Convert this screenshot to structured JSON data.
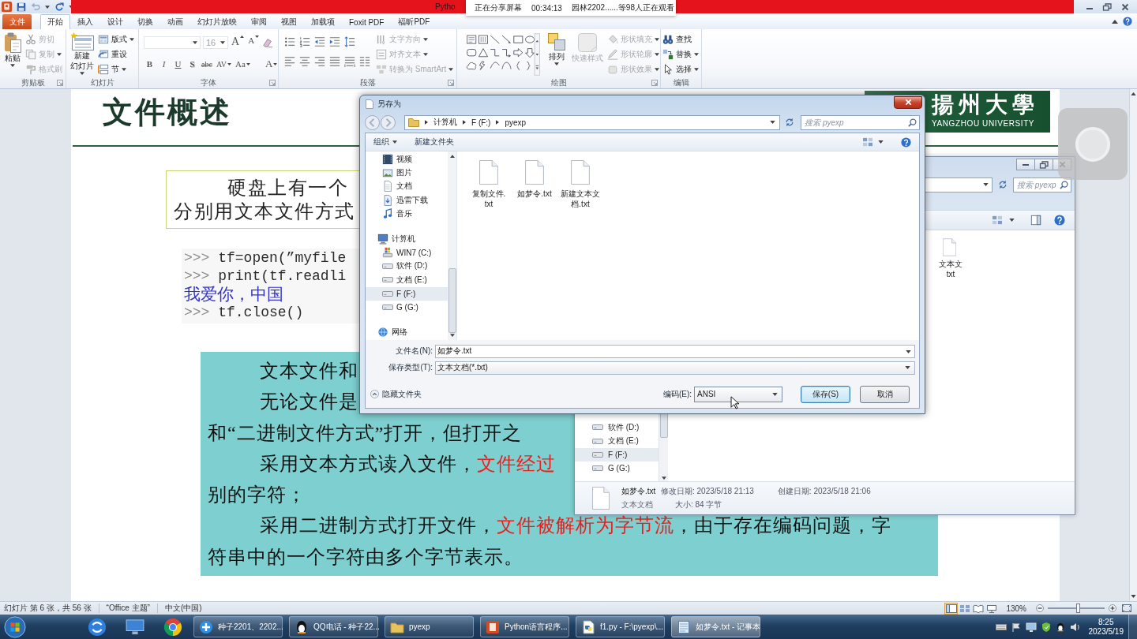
{
  "app_window": {
    "title": "Pytho"
  },
  "share_banner": {
    "status": "正在分享屏幕",
    "elapsed": "00:34:13",
    "viewers": "园林2202......等98人正在观看"
  },
  "ribbon": {
    "file_tab": "文件",
    "tabs": [
      {
        "label": "开始",
        "selected": true
      },
      {
        "label": "插入",
        "selected": false
      },
      {
        "label": "设计",
        "selected": false
      },
      {
        "label": "切换",
        "selected": false
      },
      {
        "label": "动画",
        "selected": false
      },
      {
        "label": "幻灯片放映",
        "selected": false
      },
      {
        "label": "审阅",
        "selected": false
      },
      {
        "label": "视图",
        "selected": false
      },
      {
        "label": "加载项",
        "selected": false
      },
      {
        "label": "Foxit PDF",
        "selected": false
      },
      {
        "label": "福昕PDF",
        "selected": false
      }
    ],
    "groups": [
      {
        "kind": "buttons",
        "label": "剪贴板",
        "launcher": true,
        "large": [
          {
            "kind": "paste",
            "lines": [
              "粘贴"
            ],
            "dropdown": true,
            "disabled": false
          }
        ],
        "small": [
          {
            "kind": "cut",
            "label": "剪切",
            "dropdown": false,
            "disabled": true
          },
          {
            "kind": "copy",
            "label": "复制",
            "dropdown": true,
            "disabled": true
          },
          {
            "kind": "format_painter",
            "label": "格式刷",
            "dropdown": false,
            "disabled": true
          }
        ]
      },
      {
        "kind": "buttons",
        "label": "幻灯片",
        "launcher": false,
        "large": [
          {
            "kind": "new_slide",
            "lines": [
              "新建",
              "幻灯片"
            ],
            "dropdown": true,
            "disabled": false
          }
        ],
        "small": [
          {
            "kind": "layout",
            "label": "版式",
            "dropdown": true,
            "disabled": false
          },
          {
            "kind": "reset",
            "label": "重设",
            "dropdown": false,
            "disabled": false
          },
          {
            "kind": "section",
            "label": "节",
            "dropdown": true,
            "disabled": false
          }
        ]
      },
      {
        "kind": "font",
        "label": "字体",
        "launcher": true,
        "font_size": "16",
        "size_buttons": [
          {
            "kind": "increase",
            "label": "A"
          },
          {
            "kind": "decrease",
            "label": "A"
          }
        ],
        "format_buttons": [
          {
            "kind": "bold",
            "label": "B",
            "dropdown": false
          },
          {
            "kind": "italic",
            "label": "I",
            "dropdown": false
          },
          {
            "kind": "underline",
            "label": "U",
            "dropdown": false
          },
          {
            "kind": "shadow",
            "label": "S",
            "dropdown": false
          },
          {
            "kind": "strike",
            "label": "abc",
            "dropdown": false
          },
          {
            "kind": "spacing",
            "label": "AV",
            "dropdown": true
          },
          {
            "kind": "case",
            "label": "Aa",
            "dropdown": true
          },
          {
            "kind": "color",
            "label": "A",
            "dropdown": true
          }
        ]
      },
      {
        "kind": "paragraph",
        "label": "段落",
        "launcher": true,
        "small": [
          {
            "kind": "text_direction",
            "label": "文字方向",
            "dropdown": true,
            "disabled": true
          },
          {
            "kind": "align_text",
            "label": "对齐文本",
            "dropdown": true,
            "disabled": true
          },
          {
            "kind": "smartart",
            "label": "转换为 SmartArt",
            "dropdown": true,
            "disabled": true
          }
        ]
      },
      {
        "kind": "drawing",
        "label": "绘图",
        "launcher": true,
        "large": [
          {
            "kind": "arrange",
            "lines": [
              "排列"
            ],
            "dropdown": true,
            "disabled": false
          },
          {
            "kind": "quick_styles",
            "lines": [
              "快速样式"
            ],
            "dropdown": false,
            "disabled": true
          }
        ],
        "small": [
          {
            "kind": "fill",
            "label": "形状填充",
            "dropdown": true,
            "disabled": true
          },
          {
            "kind": "outline",
            "label": "形状轮廓",
            "dropdown": true,
            "disabled": true
          },
          {
            "kind": "effects",
            "label": "形状效果",
            "dropdown": true,
            "disabled": true
          }
        ]
      },
      {
        "kind": "buttons",
        "label": "编辑",
        "launcher": false,
        "small": [
          {
            "kind": "find",
            "label": "查找",
            "dropdown": false,
            "disabled": false
          },
          {
            "kind": "replace",
            "label": "替换",
            "dropdown": true,
            "disabled": false
          },
          {
            "kind": "select",
            "label": "选择",
            "dropdown": true,
            "disabled": false
          }
        ]
      }
    ]
  },
  "slide": {
    "title": "文件概述",
    "logo": {
      "name": "揚州大學",
      "subtitle": "YANGZHOU UNIVERSITY"
    },
    "text_box": {
      "lines": [
        "硬盘上有一个",
        "分别用文本文件方式"
      ]
    },
    "console": [
      {
        "kind": "input",
        "prompt": ">>>",
        "code": "tf=open(”myfile"
      },
      {
        "kind": "input",
        "prompt": ">>>",
        "code": "print(tf.readli"
      },
      {
        "kind": "output",
        "code": "我爱你，中国"
      },
      {
        "kind": "input",
        "prompt": ">>>",
        "code": "tf.close()"
      }
    ],
    "note": {
      "paragraphs": [
        {
          "lines": [
            [
              {
                "text": "文本文件和",
                "highlight": false
              }
            ]
          ]
        },
        {
          "lines": [
            [
              {
                "text": "无论文件是",
                "highlight": false
              }
            ],
            [
              {
                "text": "和“二进制文件方式”打开，但打开之",
                "highlight": false
              }
            ]
          ]
        },
        {
          "lines": [
            [
              {
                "text": "采用文本方式读入文件，",
                "highlight": false
              },
              {
                "text": "文件经过",
                "highlight": true
              }
            ],
            [
              {
                "text": "别的字符；",
                "highlight": false
              }
            ]
          ]
        },
        {
          "lines": [
            [
              {
                "text": "采用二进制方式打开文件，",
                "highlight": false
              },
              {
                "text": "文件被解析为字节流",
                "highlight": true
              },
              {
                "text": "，由于存在编码问题，字",
                "highlight": false
              }
            ],
            [
              {
                "text": "符串中的一个字符由多个字节表示。",
                "highlight": false
              }
            ]
          ]
        }
      ]
    }
  },
  "explorer_window": {
    "search": {
      "placeholder": "搜索 pyexp"
    },
    "file": {
      "lines": [
        "文本文",
        "txt"
      ]
    },
    "nav": [
      {
        "label": "软件 (D:)",
        "selected": false
      },
      {
        "label": "文档 (E:)",
        "selected": false
      },
      {
        "label": "F (F:)",
        "selected": true
      },
      {
        "label": "G (G:)",
        "selected": false
      }
    ],
    "details": {
      "name": "如梦令.txt",
      "modified": "修改日期: 2023/5/18 21:13",
      "created": "创建日期: 2023/5/18 21:06",
      "type": "文本文档",
      "size": "大小: 84 字节"
    }
  },
  "save_dialog": {
    "title": "另存为",
    "breadcrumb": [
      "计算机",
      "F (F:)",
      "pyexp"
    ],
    "search": {
      "placeholder": "搜索 pyexp"
    },
    "toolbar": {
      "organize": "组织",
      "new_folder": "新建文件夹"
    },
    "nav": [
      {
        "kind": "video",
        "label": "视频",
        "selected": false
      },
      {
        "kind": "pictures",
        "label": "图片",
        "selected": false
      },
      {
        "kind": "documents",
        "label": "文档",
        "selected": false
      },
      {
        "kind": "downloads",
        "label": "迅雷下载",
        "selected": false
      },
      {
        "kind": "music",
        "label": "音乐",
        "selected": false
      },
      {
        "kind": "computer",
        "label": "计算机",
        "selected": false
      },
      {
        "kind": "system_drive",
        "label": "WIN7 (C:)",
        "selected": false
      },
      {
        "kind": "drive",
        "label": "软件 (D:)",
        "selected": false
      },
      {
        "kind": "drive",
        "label": "文档 (E:)",
        "selected": false
      },
      {
        "kind": "drive",
        "label": "F (F:)",
        "selected": true
      },
      {
        "kind": "drive",
        "label": "G (G:)",
        "selected": false
      },
      {
        "kind": "network",
        "label": "网络",
        "selected": false
      }
    ],
    "files": [
      {
        "lines": [
          "复制文件.",
          "txt"
        ]
      },
      {
        "lines": [
          "如梦令.txt"
        ]
      },
      {
        "lines": [
          "新建文本文",
          "档.txt"
        ]
      }
    ],
    "file_name": {
      "label": "文件名(N):",
      "value": "如梦令.txt"
    },
    "file_type": {
      "label": "保存类型(T):",
      "value": "文本文档(*.txt)"
    },
    "hide_folders": "隐藏文件夹",
    "encoding": {
      "label": "编码(E):",
      "value": "ANSI"
    },
    "buttons": [
      {
        "label": "保存(S)",
        "kind": "default"
      },
      {
        "label": "取消",
        "kind": "normal"
      }
    ]
  },
  "status_bar": {
    "slide_info": "幻灯片 第 6 张，共 56 张",
    "theme": "“Office 主题”",
    "language": "中文(中国)",
    "view_buttons": [
      {
        "kind": "normal",
        "selected": true
      },
      {
        "kind": "sorter",
        "selected": false
      },
      {
        "kind": "reading",
        "selected": false
      },
      {
        "kind": "slideshow",
        "selected": false
      }
    ],
    "zoom": "130%",
    "zoom_slider": {
      "level": 0.53
    }
  },
  "taskbar": {
    "tasks": [
      {
        "kind": "meeting",
        "label": "种子2201、2202...",
        "selected": false
      },
      {
        "kind": "chat",
        "label": "QQ电话 - 种子22...",
        "selected": false
      },
      {
        "kind": "folder",
        "label": "pyexp",
        "selected": false
      },
      {
        "kind": "presentation",
        "label": "Python语言程序...",
        "selected": false
      },
      {
        "kind": "script",
        "label": "f1.py - F:\\pyexp\\...",
        "selected": false
      },
      {
        "kind": "notepad",
        "label": "如梦令.txt - 记事本",
        "selected": true
      }
    ],
    "clock": {
      "time": "8:25",
      "date": "2023/5/19"
    }
  }
}
